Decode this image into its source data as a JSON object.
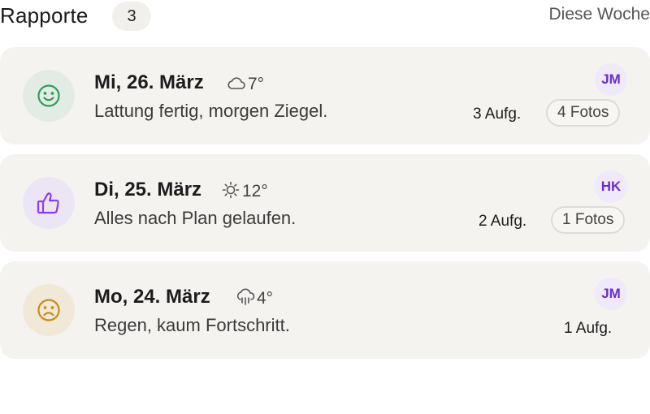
{
  "header": {
    "title": "Rapporte",
    "count": "3",
    "period": "Diese Woche"
  },
  "reports": [
    {
      "date": "Mi, 26. März",
      "weather_icon": "cloud-icon",
      "temp": "7°",
      "note": "Lattung fertig, morgen Ziegel.",
      "mood_icon": "smiley-happy-icon",
      "mood_color": "#2f9e5a",
      "mood_bg": "#e3ece4",
      "avatar": "JM",
      "tasks": "3 Aufg.",
      "photos": "4 Fotos"
    },
    {
      "date": "Di, 25. März",
      "weather_icon": "sun-icon",
      "temp": "12°",
      "note": "Alles nach Plan gelaufen.",
      "mood_icon": "thumbs-up-icon",
      "mood_color": "#8a3ff0",
      "mood_bg": "#ece5f6",
      "avatar": "HK",
      "tasks": "2 Aufg.",
      "photos": "1 Fotos"
    },
    {
      "date": "Mo, 24. März",
      "weather_icon": "rain-cloud-icon",
      "temp": "4°",
      "note": "Regen, kaum Fortschritt.",
      "mood_icon": "smiley-sad-icon",
      "mood_color": "#cc8a16",
      "mood_bg": "#f1e9d8",
      "avatar": "JM",
      "tasks": "1 Aufg."
    }
  ]
}
